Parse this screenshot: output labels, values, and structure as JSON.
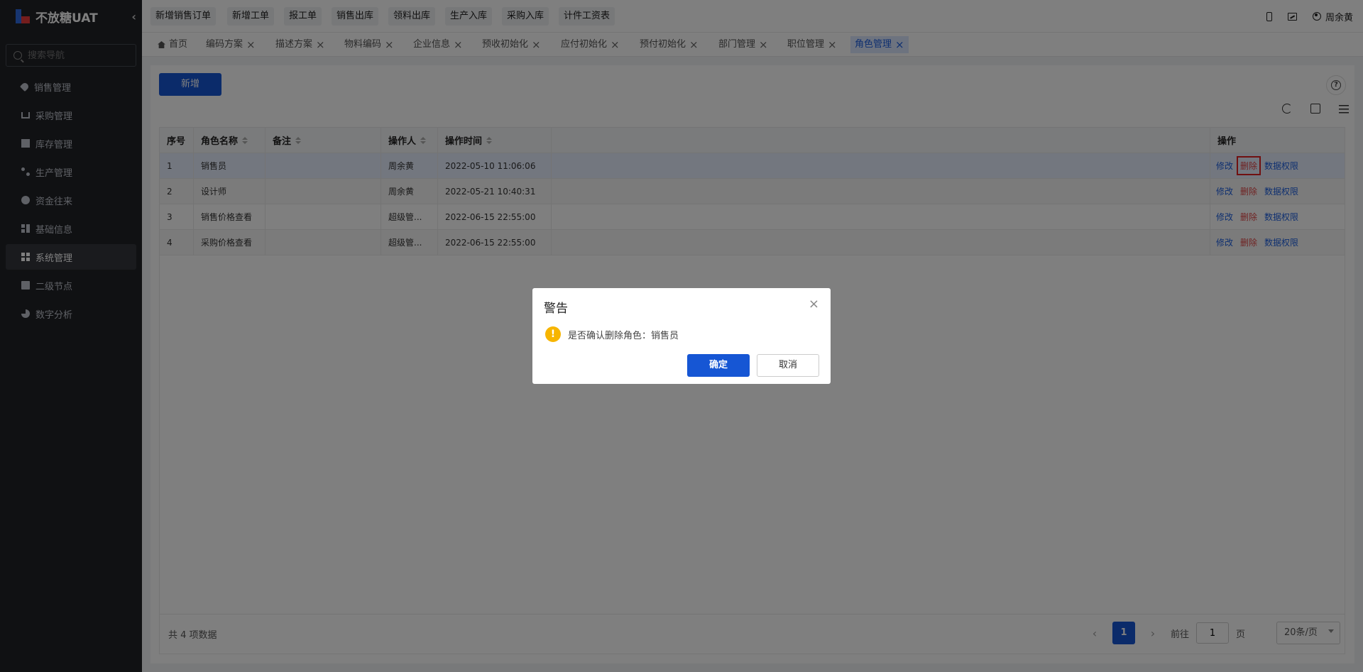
{
  "app": {
    "title": "不放糖UAT"
  },
  "sidebar": {
    "search_placeholder": "搜索导航",
    "items": [
      {
        "label": "销售管理",
        "icon": "tag-icon"
      },
      {
        "label": "采购管理",
        "icon": "cart-icon"
      },
      {
        "label": "库存管理",
        "icon": "box-icon"
      },
      {
        "label": "生产管理",
        "icon": "tree-icon"
      },
      {
        "label": "资金往来",
        "icon": "coin-icon"
      },
      {
        "label": "基础信息",
        "icon": "grid-icon"
      },
      {
        "label": "系统管理",
        "icon": "apps-icon",
        "active": true
      },
      {
        "label": "二级节点",
        "icon": "doc-icon"
      },
      {
        "label": "数字分析",
        "icon": "pie-icon"
      }
    ]
  },
  "topbar": {
    "quick_links": [
      "新增销售订单",
      "新增工单",
      "报工单",
      "销售出库",
      "领料出库",
      "生产入库",
      "采购入库",
      "计件工资表"
    ],
    "user": "周余黄"
  },
  "tabs": [
    {
      "label": "首页"
    },
    {
      "label": "编码方案"
    },
    {
      "label": "描述方案"
    },
    {
      "label": "物料编码"
    },
    {
      "label": "企业信息"
    },
    {
      "label": "预收初始化"
    },
    {
      "label": "应付初始化"
    },
    {
      "label": "预付初始化"
    },
    {
      "label": "部门管理"
    },
    {
      "label": "职位管理"
    },
    {
      "label": "角色管理",
      "active": true
    }
  ],
  "toolbar": {
    "new_label": "新增"
  },
  "table": {
    "headers": {
      "index": "序号",
      "role": "角色名称",
      "remark": "备注",
      "operator": "操作人",
      "time": "操作时间",
      "actions": "操作"
    },
    "rows": [
      {
        "index": "1",
        "role": "销售员",
        "remark": "",
        "operator": "周余黄",
        "time": "2022-05-10 11:06:06"
      },
      {
        "index": "2",
        "role": "设计师",
        "remark": "",
        "operator": "周余黄",
        "time": "2022-05-21 10:40:31"
      },
      {
        "index": "3",
        "role": "销售价格查看",
        "remark": "",
        "operator": "超级管...",
        "time": "2022-06-15 22:55:00"
      },
      {
        "index": "4",
        "role": "采购价格查看",
        "remark": "",
        "operator": "超级管...",
        "time": "2022-06-15 22:55:00"
      }
    ],
    "actions": {
      "edit": "修改",
      "delete": "删除",
      "perm": "数据权限"
    }
  },
  "pagination": {
    "total": "共 4 项数据",
    "current": "1",
    "goto_prefix": "前往",
    "goto_value": "1",
    "goto_suffix": "页",
    "page_size": "20条/页"
  },
  "dialog": {
    "title": "警告",
    "message": "是否确认删除角色：销售员",
    "ok": "确定",
    "cancel": "取消"
  },
  "colors": {
    "primary": "#1656d4",
    "sidebar_bg": "#202227",
    "danger": "#e04545",
    "warning": "#f7b500"
  }
}
